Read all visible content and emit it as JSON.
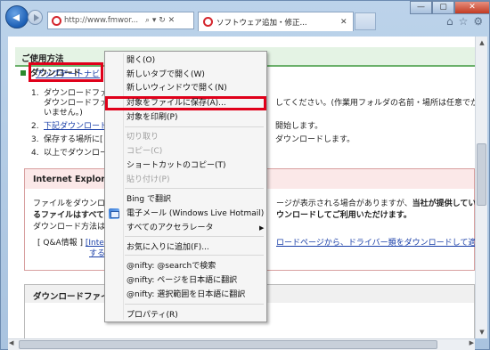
{
  "browser": {
    "address_url": "http://www.fmwor...",
    "address_icons": "⌕ ▾ ↻ ✕",
    "tab_title": "ソフトウェア追加・修正...",
    "tab_close": "✕",
    "window_min": "—",
    "window_max": "▢",
    "window_close": "✕",
    "toolbar_icons": [
      "home-icon",
      "favorites-star-icon",
      "tools-gear-icon"
    ]
  },
  "page": {
    "section_title": "ご使用方法",
    "download_heading": "ダウンロード",
    "steps": [
      {
        "num": "1.",
        "lines": [
          "ダウンロードファ",
          "ダウンロードファ"
        ],
        "right": "してください。(作業用フォルダの名前・場所は任意でかま",
        "cont": "いません。)"
      },
      {
        "num": "2.",
        "link": "下記ダウンロード",
        "right": "開始します。"
      },
      {
        "num": "3.",
        "text": "保存する場所に[",
        "right": "ダウンロードします。"
      },
      {
        "num": "4.",
        "text": "以上でダウンロー"
      }
    ],
    "ie_box": {
      "title": "Internet Explore",
      "line1_left": "ファイルをダウンロー",
      "line1_right": "ージが表示される場合がありますが、",
      "line1_bold": "当社が提供してい",
      "line2_bold_left": "るファイルはすべて",
      "line2_bold_right": "ウンロードしてご利用いただけます。",
      "line3": "ダウンロード方法は",
      "qa_label": "[ Q&A情報 ]",
      "qa_link_left": "[Inte",
      "qa_link_right": "ロードページから、ドライバー類をダウンロードして適用",
      "qa_link2": "する"
    },
    "dl_box": {
      "title": "ダウンロードファイ",
      "link": "アップデートナビ"
    }
  },
  "context_menu": {
    "items": [
      {
        "label": "開く(O)",
        "disabled": false
      },
      {
        "label": "新しいタブで開く(W)",
        "disabled": false
      },
      {
        "label": "新しいウィンドウで開く(N)",
        "disabled": false
      },
      {
        "label": "対象をファイルに保存(A)...",
        "disabled": false,
        "highlighted": true
      },
      {
        "label": "対象を印刷(P)",
        "disabled": false
      },
      {
        "label": "切り取り",
        "disabled": true
      },
      {
        "label": "コピー(C)",
        "disabled": true
      },
      {
        "label": "ショートカットのコピー(T)",
        "disabled": false
      },
      {
        "label": "貼り付け(P)",
        "disabled": true
      },
      {
        "label": "Bing で翻訳",
        "disabled": false
      },
      {
        "label": "電子メール (Windows Live Hotmail)",
        "disabled": false
      },
      {
        "label": "すべてのアクセラレータ",
        "disabled": false,
        "submenu": true
      },
      {
        "label": "お気に入りに追加(F)...",
        "disabled": false
      },
      {
        "label": "@nifty: @searchで検索",
        "disabled": false
      },
      {
        "label": "@nifty: ページを日本語に翻訳",
        "disabled": false
      },
      {
        "label": "@nifty: 選択範囲を日本語に翻訳",
        "disabled": false
      },
      {
        "label": "プロパティ(R)",
        "disabled": false
      }
    ],
    "submenu_arrow": "▶"
  },
  "colors": {
    "highlight_border": "#e0001a",
    "section_bar": "#e4f3e4",
    "link": "#1a3fa8"
  }
}
